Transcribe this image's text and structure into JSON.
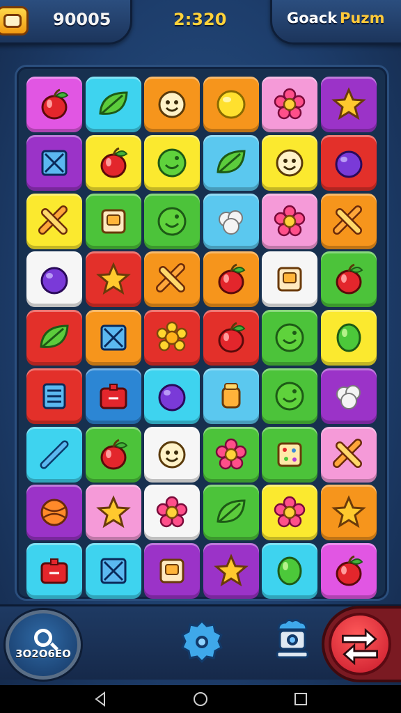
{
  "hud": {
    "score": "90005",
    "timer": "2:320",
    "title_part1": "Goack",
    "title_part2": "Puzm"
  },
  "colors": {
    "magenta": "#e156e3",
    "cyan": "#3ed3ef",
    "orange": "#f6951c",
    "yellow": "#fbe92f",
    "pink": "#f59ad8",
    "purple": "#9b33c8",
    "red": "#e3302a",
    "green": "#4cc33a",
    "sky": "#5bc8ef",
    "white": "#f6f6f6",
    "blue": "#2c86d4"
  },
  "board": {
    "rows": [
      [
        {
          "bg": "magenta",
          "icon": "apple-icon"
        },
        {
          "bg": "cyan",
          "icon": "leaf-icon"
        },
        {
          "bg": "orange",
          "icon": "smiley-face-icon"
        },
        {
          "bg": "orange",
          "icon": "yellow-orb-icon"
        },
        {
          "bg": "pink",
          "icon": "flower-icon"
        },
        {
          "bg": "purple",
          "icon": "star-icon"
        }
      ],
      [
        {
          "bg": "purple",
          "icon": "crossed-box-icon"
        },
        {
          "bg": "yellow",
          "icon": "apple-icon"
        },
        {
          "bg": "yellow",
          "icon": "green-smiley-icon"
        },
        {
          "bg": "sky",
          "icon": "leaf-icon"
        },
        {
          "bg": "yellow",
          "icon": "smiley-face-icon"
        },
        {
          "bg": "red",
          "icon": "plum-icon"
        }
      ],
      [
        {
          "bg": "yellow",
          "icon": "cross-candy-icon"
        },
        {
          "bg": "green",
          "icon": "box-icon"
        },
        {
          "bg": "green",
          "icon": "green-smiley-icon"
        },
        {
          "bg": "sky",
          "icon": "cotton-icon"
        },
        {
          "bg": "pink",
          "icon": "flower-icon"
        },
        {
          "bg": "orange",
          "icon": "cross-candy-icon"
        }
      ],
      [
        {
          "bg": "white",
          "icon": "plum-icon"
        },
        {
          "bg": "red",
          "icon": "star-icon"
        },
        {
          "bg": "orange",
          "icon": "cross-candy-icon"
        },
        {
          "bg": "orange",
          "icon": "apple-icon"
        },
        {
          "bg": "white",
          "icon": "box-icon"
        },
        {
          "bg": "green",
          "icon": "apple-icon"
        }
      ],
      [
        {
          "bg": "red",
          "icon": "leaf-icon"
        },
        {
          "bg": "orange",
          "icon": "crossed-box-icon"
        },
        {
          "bg": "red",
          "icon": "sun-flower-icon"
        },
        {
          "bg": "red",
          "icon": "apple-icon"
        },
        {
          "bg": "green",
          "icon": "green-smiley-icon"
        },
        {
          "bg": "yellow",
          "icon": "lime-icon"
        }
      ],
      [
        {
          "bg": "red",
          "icon": "striped-box-icon"
        },
        {
          "bg": "blue",
          "icon": "gift-icon"
        },
        {
          "bg": "cyan",
          "icon": "plum-icon"
        },
        {
          "bg": "sky",
          "icon": "jar-icon"
        },
        {
          "bg": "green",
          "icon": "green-smiley-icon"
        },
        {
          "bg": "purple",
          "icon": "cotton-icon"
        }
      ],
      [
        {
          "bg": "cyan",
          "icon": "stick-icon"
        },
        {
          "bg": "green",
          "icon": "apple-icon"
        },
        {
          "bg": "white",
          "icon": "smiley-face-icon"
        },
        {
          "bg": "green",
          "icon": "flower-icon"
        },
        {
          "bg": "green",
          "icon": "dotted-box-icon"
        },
        {
          "bg": "pink",
          "icon": "cross-candy-icon"
        }
      ],
      [
        {
          "bg": "purple",
          "icon": "ball-icon"
        },
        {
          "bg": "pink",
          "icon": "star-icon"
        },
        {
          "bg": "white",
          "icon": "flower-icon"
        },
        {
          "bg": "green",
          "icon": "leaf-icon"
        },
        {
          "bg": "yellow",
          "icon": "flower-icon"
        },
        {
          "bg": "orange",
          "icon": "star-icon"
        }
      ],
      [
        {
          "bg": "cyan",
          "icon": "gift-icon"
        },
        {
          "bg": "cyan",
          "icon": "crossed-box-icon"
        },
        {
          "bg": "purple",
          "icon": "box-icon"
        },
        {
          "bg": "purple",
          "icon": "star-icon"
        },
        {
          "bg": "cyan",
          "icon": "lime-icon"
        },
        {
          "bg": "magenta",
          "icon": "apple-icon"
        }
      ]
    ]
  },
  "bottom": {
    "hint_label": "3O2O6EO"
  }
}
